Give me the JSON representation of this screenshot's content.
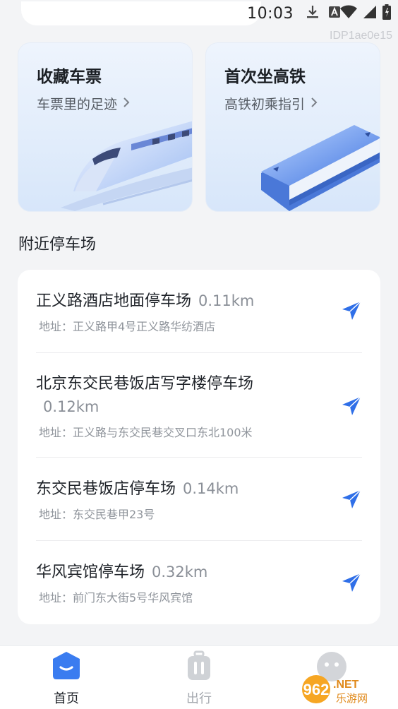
{
  "status_bar": {
    "time": "10:03"
  },
  "watermark": "IDP1ae0e15",
  "cards": [
    {
      "title": "收藏车票",
      "subtitle": "车票里的足迹"
    },
    {
      "title": "首次坐高铁",
      "subtitle": "高铁初乘指引"
    }
  ],
  "section_title": "附近停车场",
  "parking": [
    {
      "name": "正义路酒店地面停车场",
      "distance": "0.11km",
      "address": "地址：正义路甲4号正义路华纺酒店"
    },
    {
      "name": "北京东交民巷饭店写字楼停车场",
      "distance": "0.12km",
      "address": "地址：正义路与东交民巷交叉口东北100米"
    },
    {
      "name": "东交民巷饭店停车场",
      "distance": "0.14km",
      "address": "地址：东交民巷甲23号"
    },
    {
      "name": "华风宾馆停车场",
      "distance": "0.32km",
      "address": "地址：前门东大街5号华风宾馆"
    }
  ],
  "bottom_nav": {
    "home_label": "首页",
    "trip_label": "出行"
  },
  "logo": {
    "number": "962",
    "suffix": ".NET",
    "caption": "乐游网"
  },
  "colors": {
    "accent": "#3a7cf0",
    "nav_arrow": "#2f6fe8",
    "inactive": "#a5a9af"
  }
}
